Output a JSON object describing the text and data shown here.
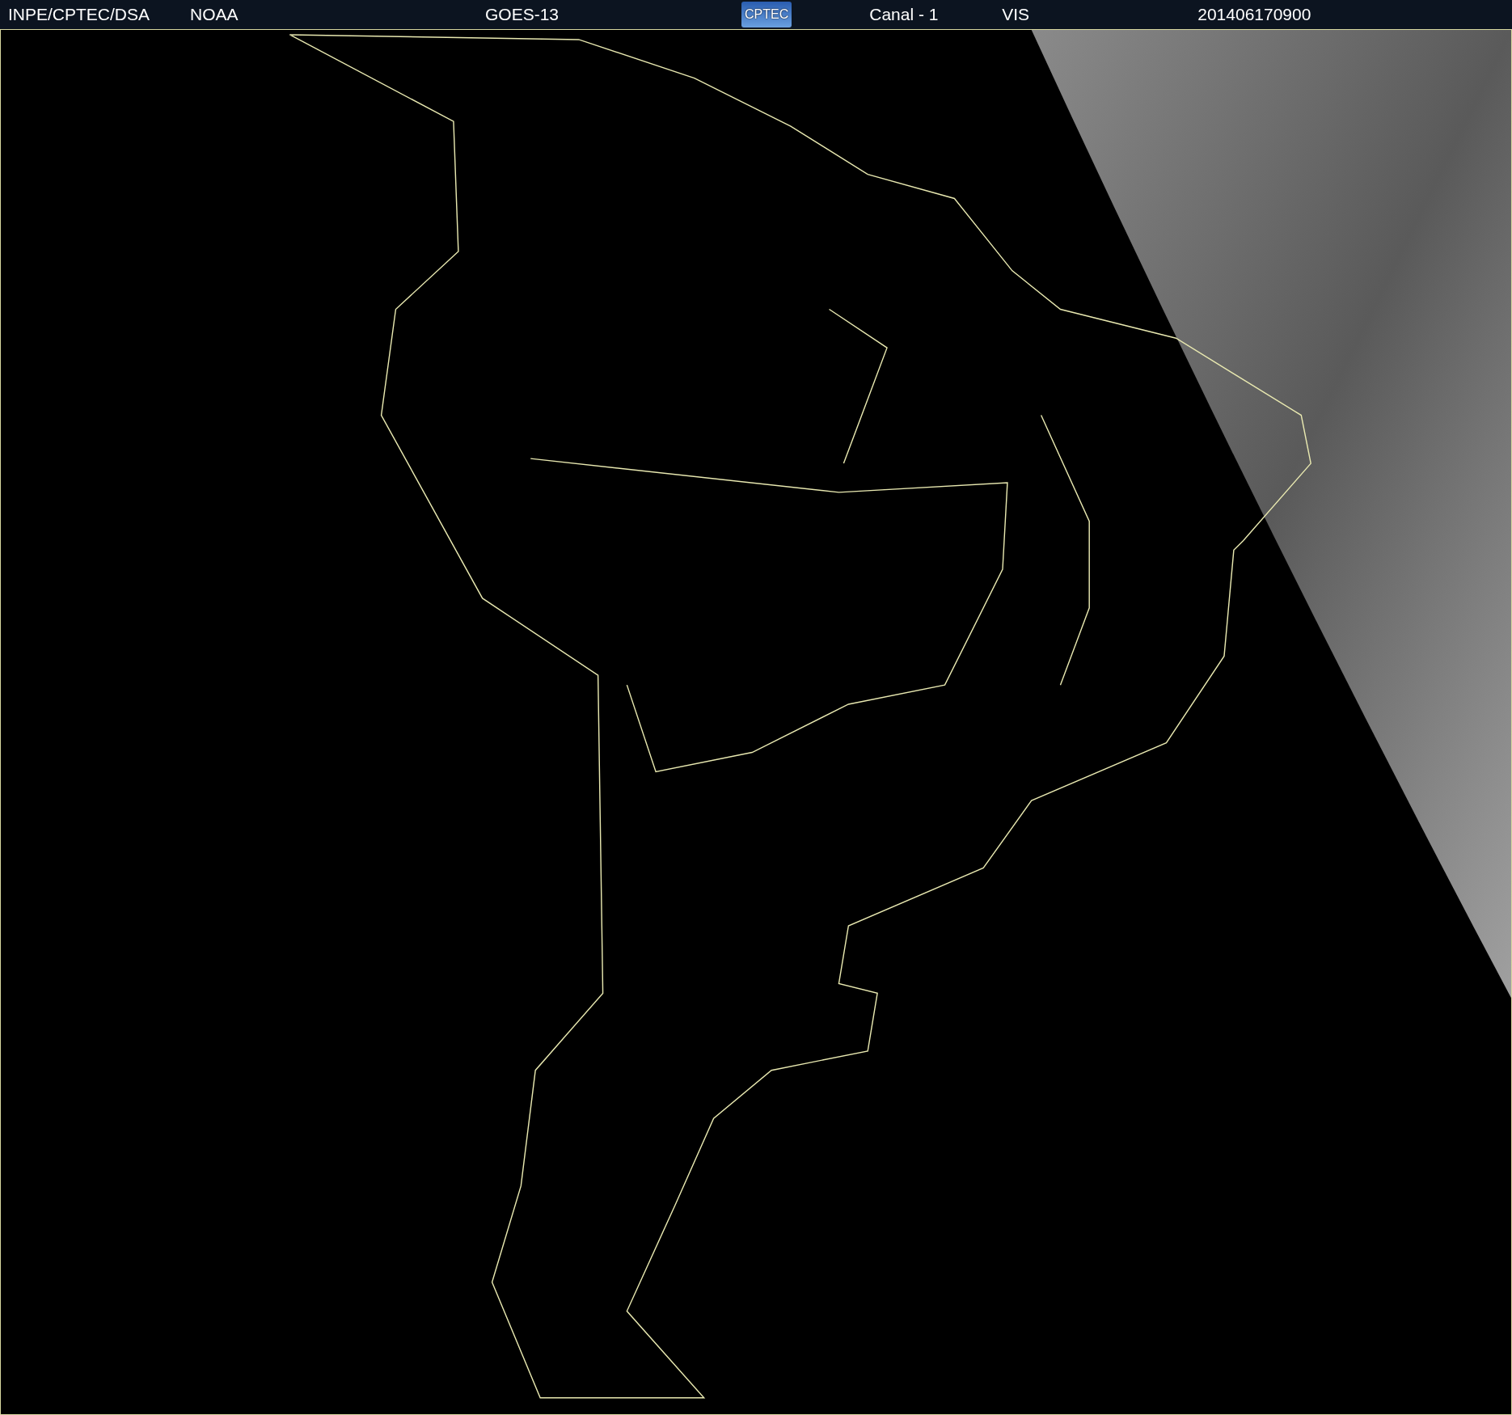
{
  "header": {
    "items": [
      {
        "kind": "text",
        "text": "INPE/CPTEC/DSA"
      },
      {
        "kind": "text",
        "text": "NOAA"
      },
      {
        "kind": "text",
        "text": "GOES-13"
      },
      {
        "kind": "logo",
        "text": "CPTEC"
      },
      {
        "kind": "text",
        "text": "Canal - 1"
      },
      {
        "kind": "text",
        "text": "VIS"
      },
      {
        "kind": "text",
        "text": "201406170900"
      }
    ]
  }
}
